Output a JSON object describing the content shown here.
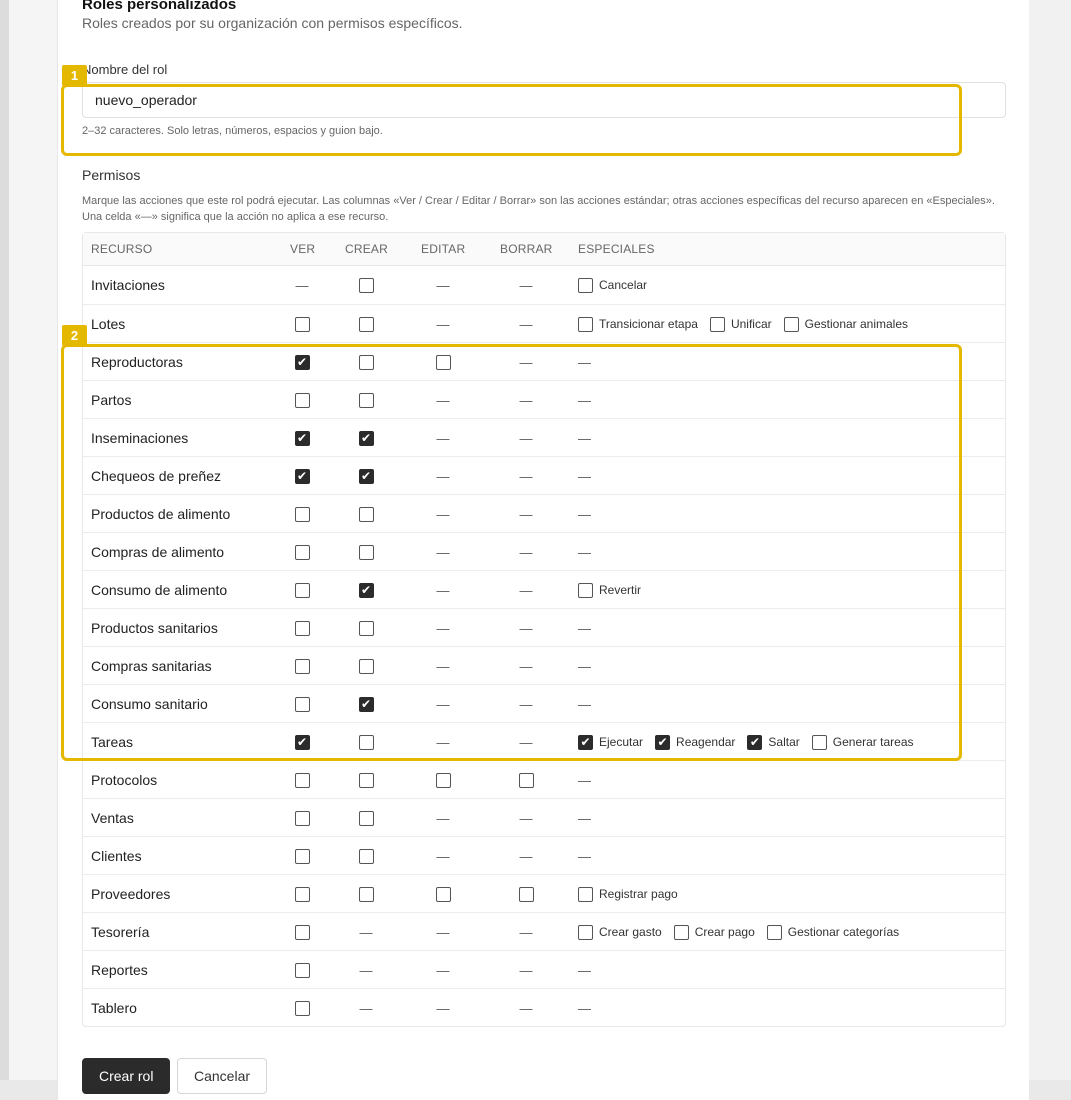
{
  "header": {
    "title": "Roles personalizados",
    "subtitle": "Roles creados por su organización con permisos específicos."
  },
  "role_name": {
    "label": "Nombre del rol",
    "value": "nuevo_operador",
    "help": "2–32 caracteres. Solo letras, números, espacios y guion bajo."
  },
  "permissions": {
    "label": "Permisos",
    "help": "Marque las acciones que este rol podrá ejecutar. Las columnas «Ver / Crear / Editar / Borrar» son las acciones estándar; otras acciones específicas del recurso aparecen en «Especiales». Una celda «—» significa que la acción no aplica a ese recurso.",
    "columns": [
      "RECURSO",
      "VER",
      "CREAR",
      "EDITAR",
      "BORRAR",
      "ESPECIALES"
    ],
    "na_symbol": "—",
    "rows": [
      {
        "resource": "Invitaciones",
        "ver": null,
        "crear": false,
        "editar": null,
        "borrar": null,
        "especiales": [
          {
            "label": "Cancelar",
            "checked": false
          }
        ]
      },
      {
        "resource": "Lotes",
        "ver": false,
        "crear": false,
        "editar": null,
        "borrar": null,
        "especiales": [
          {
            "label": "Transicionar etapa",
            "checked": false
          },
          {
            "label": "Unificar",
            "checked": false
          },
          {
            "label": "Gestionar animales",
            "checked": false
          }
        ]
      },
      {
        "resource": "Reproductoras",
        "ver": true,
        "crear": false,
        "editar": false,
        "borrar": null,
        "especiales": []
      },
      {
        "resource": "Partos",
        "ver": false,
        "crear": false,
        "editar": null,
        "borrar": null,
        "especiales": []
      },
      {
        "resource": "Inseminaciones",
        "ver": true,
        "crear": true,
        "editar": null,
        "borrar": null,
        "especiales": []
      },
      {
        "resource": "Chequeos de preñez",
        "ver": true,
        "crear": true,
        "editar": null,
        "borrar": null,
        "especiales": []
      },
      {
        "resource": "Productos de alimento",
        "ver": false,
        "crear": false,
        "editar": null,
        "borrar": null,
        "especiales": []
      },
      {
        "resource": "Compras de alimento",
        "ver": false,
        "crear": false,
        "editar": null,
        "borrar": null,
        "especiales": []
      },
      {
        "resource": "Consumo de alimento",
        "ver": false,
        "crear": true,
        "editar": null,
        "borrar": null,
        "especiales": [
          {
            "label": "Revertir",
            "checked": false
          }
        ]
      },
      {
        "resource": "Productos sanitarios",
        "ver": false,
        "crear": false,
        "editar": null,
        "borrar": null,
        "especiales": []
      },
      {
        "resource": "Compras sanitarias",
        "ver": false,
        "crear": false,
        "editar": null,
        "borrar": null,
        "especiales": []
      },
      {
        "resource": "Consumo sanitario",
        "ver": false,
        "crear": true,
        "editar": null,
        "borrar": null,
        "especiales": []
      },
      {
        "resource": "Tareas",
        "ver": true,
        "crear": false,
        "editar": null,
        "borrar": null,
        "especiales": [
          {
            "label": "Ejecutar",
            "checked": true
          },
          {
            "label": "Reagendar",
            "checked": true
          },
          {
            "label": "Saltar",
            "checked": true
          },
          {
            "label": "Generar tareas",
            "checked": false
          }
        ]
      },
      {
        "resource": "Protocolos",
        "ver": false,
        "crear": false,
        "editar": false,
        "borrar": false,
        "especiales": []
      },
      {
        "resource": "Ventas",
        "ver": false,
        "crear": false,
        "editar": null,
        "borrar": null,
        "especiales": []
      },
      {
        "resource": "Clientes",
        "ver": false,
        "crear": false,
        "editar": null,
        "borrar": null,
        "especiales": []
      },
      {
        "resource": "Proveedores",
        "ver": false,
        "crear": false,
        "editar": false,
        "borrar": false,
        "especiales": [
          {
            "label": "Registrar pago",
            "checked": false
          }
        ]
      },
      {
        "resource": "Tesorería",
        "ver": false,
        "crear": null,
        "editar": null,
        "borrar": null,
        "especiales": [
          {
            "label": "Crear gasto",
            "checked": false
          },
          {
            "label": "Crear pago",
            "checked": false
          },
          {
            "label": "Gestionar categorías",
            "checked": false
          }
        ]
      },
      {
        "resource": "Reportes",
        "ver": false,
        "crear": null,
        "editar": null,
        "borrar": null,
        "especiales": []
      },
      {
        "resource": "Tablero",
        "ver": false,
        "crear": null,
        "editar": null,
        "borrar": null,
        "especiales": []
      }
    ]
  },
  "actions": {
    "create_label": "Crear rol",
    "cancel_label": "Cancelar"
  },
  "highlights": {
    "colors": {
      "accent": "#e5b800"
    },
    "box1_label": "1",
    "box2_label": "2"
  }
}
